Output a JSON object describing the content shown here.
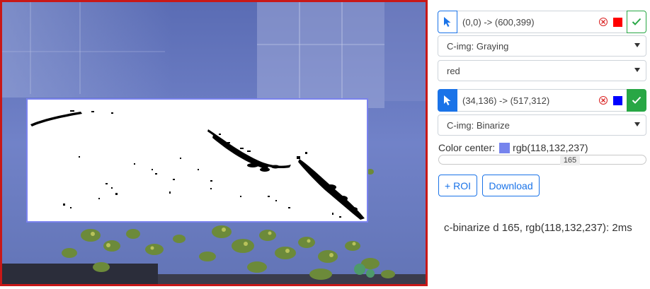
{
  "rois": [
    {
      "coords": "(0,0) -> (600,399)",
      "color": "#ff0000",
      "filter_select": "C-img: Graying",
      "channel_select": "red",
      "selected": false
    },
    {
      "coords": "(34,136) -> (517,312)",
      "color": "#0000ff",
      "filter_select": "C-img: Binarize",
      "selected": true
    }
  ],
  "color_center": {
    "label": "Color center:",
    "value": "rgb(118,132,237)",
    "swatch_color": "#7684ed"
  },
  "threshold": {
    "value": 165,
    "value_label": "165",
    "max": 255
  },
  "buttons": {
    "add_roi": "+ ROI",
    "download": "Download"
  },
  "status": "c-binarize d 165, rgb(118,132,237): 2ms",
  "colors": {
    "canvas_border": "#c81818",
    "roi_border": "#7a82ee",
    "primary": "#1a73e8",
    "success": "#28a745"
  }
}
